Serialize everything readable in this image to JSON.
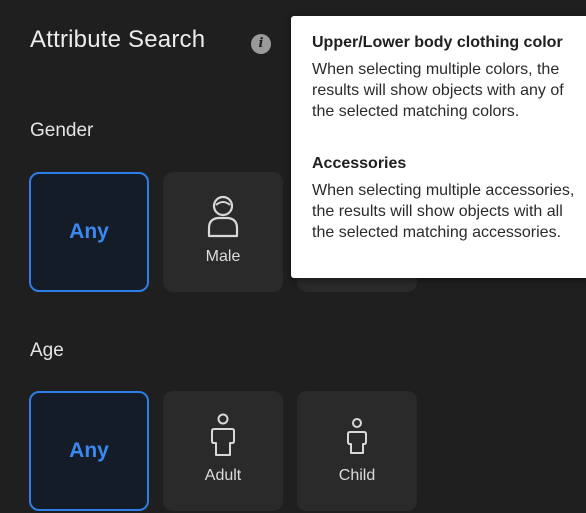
{
  "panel": {
    "title": "Attribute Search",
    "info_icon": "info-icon"
  },
  "gender": {
    "label": "Gender",
    "options": [
      {
        "label": "Any",
        "selected": true
      },
      {
        "label": "Male",
        "icon": "male-person-icon",
        "selected": false
      }
    ]
  },
  "age": {
    "label": "Age",
    "options": [
      {
        "label": "Any",
        "selected": true
      },
      {
        "label": "Adult",
        "icon": "adult-person-icon",
        "selected": false
      },
      {
        "label": "Child",
        "icon": "child-person-icon",
        "selected": false
      }
    ]
  },
  "tooltip": {
    "clothing_heading": "Upper/Lower body clothing color",
    "clothing_text": "When selecting multiple colors, the results will show objects with any of the selected matching colors.",
    "accessories_heading": "Accessories",
    "accessories_text": "When selecting multiple accessories, the results will show objects with all the selected matching accessories."
  },
  "colors": {
    "background": "#1f1f1f",
    "tile": "#2a2a2a",
    "selected_border": "#2f7de6",
    "selected_text": "#3a88f0"
  }
}
